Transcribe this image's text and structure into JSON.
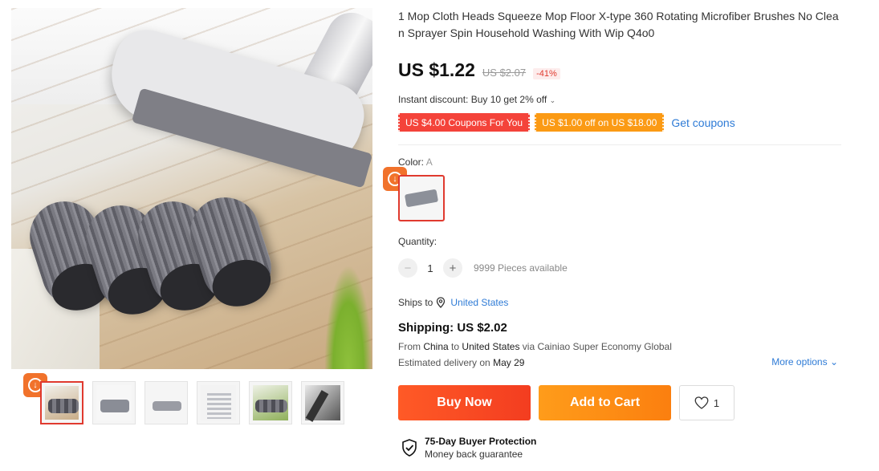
{
  "product": {
    "title": "1 Mop Cloth Heads Squeeze Mop Floor X-type 360 Rotating Microfiber Brushes No Clean Sprayer Spin Household Washing With Wip Q4o0"
  },
  "price": {
    "current": "US $1.22",
    "original": "US $2.07",
    "discount": "-41%"
  },
  "promo": {
    "instant_discount": "Instant discount: Buy 10 get 2% off",
    "coupons": [
      "US $4.00 Coupons For You",
      "US $1.00 off on US $18.00"
    ],
    "get_coupons": "Get coupons"
  },
  "color": {
    "label": "Color:",
    "selected": "A"
  },
  "quantity": {
    "label": "Quantity:",
    "minus": "−",
    "value": "1",
    "plus": "+",
    "available": "9999 Pieces available"
  },
  "shipping": {
    "ships_to_label": "Ships to",
    "ships_to_country": "United States",
    "title": "Shipping: US $2.02",
    "from_prefix": "From",
    "from": "China",
    "to_word": "to",
    "to": "United States",
    "via": "via Cainiao Super Economy Global",
    "delivery_prefix": "Estimated delivery on",
    "delivery_date": "May 29",
    "more_options": "More options"
  },
  "actions": {
    "buy_now": "Buy Now",
    "add_to_cart": "Add to Cart",
    "wishlist_count": "1"
  },
  "protection": {
    "title": "75-Day Buyer Protection",
    "subtitle": "Money back guarantee"
  },
  "icons": {
    "download": "download-icon",
    "heart": "heart-icon",
    "location": "location-pin-icon",
    "shield": "shield-check-icon"
  },
  "colors": {
    "accent_red": "#f4433a",
    "accent_orange": "#fb9a14",
    "link_blue": "#2e7bd6"
  }
}
